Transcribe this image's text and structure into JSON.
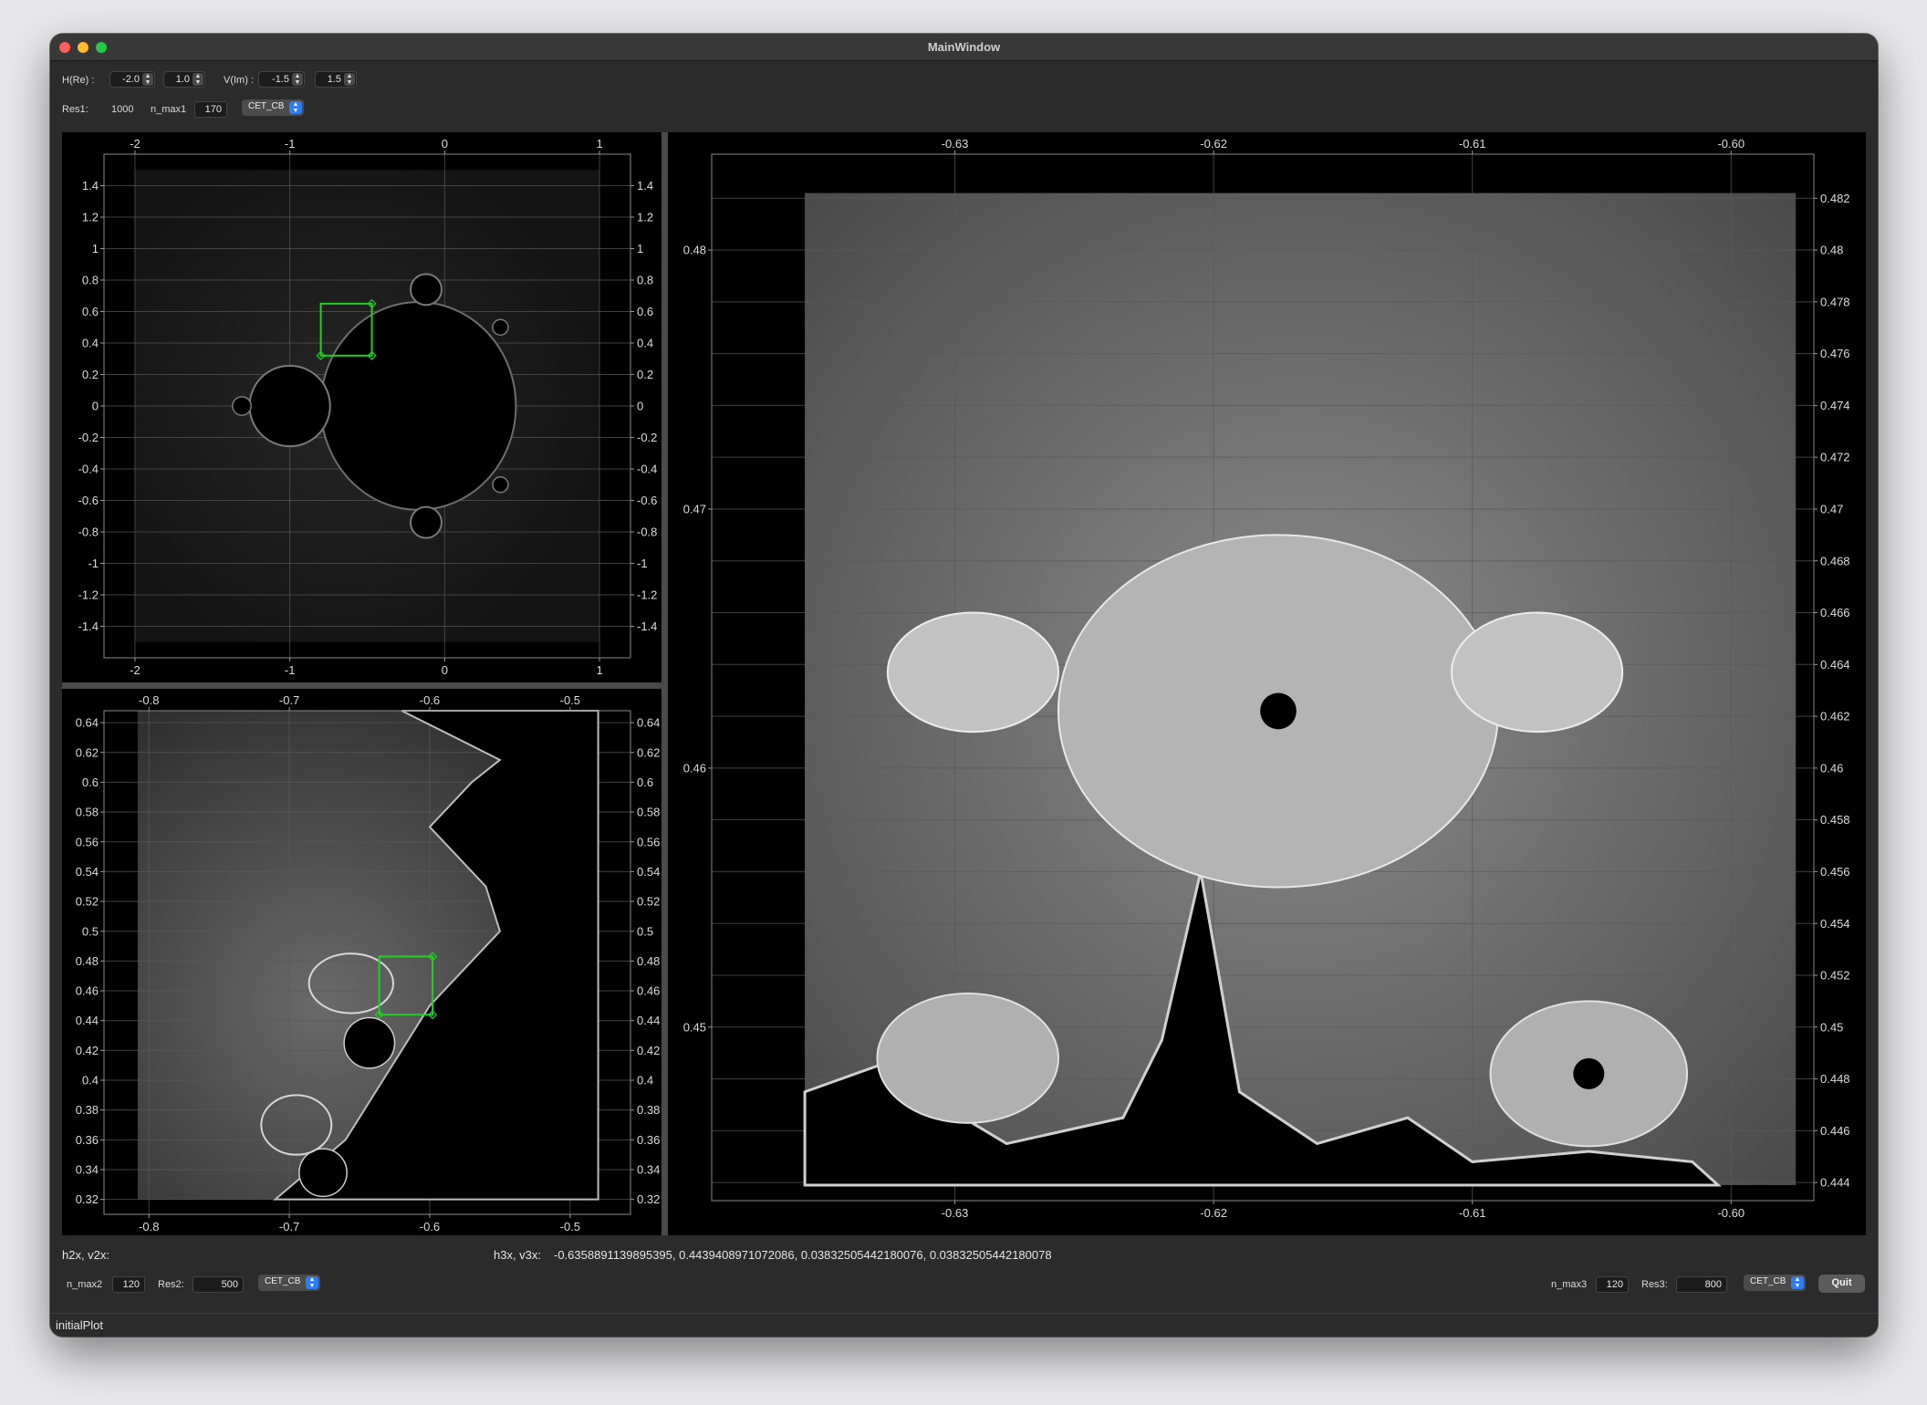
{
  "window": {
    "title": "MainWindow"
  },
  "toolbar1": {
    "h_label": "H(Re) :",
    "h_min": "-2.0",
    "h_max": "1.0",
    "v_label": "V(Im) :",
    "v_min": "-1.5",
    "v_max": "1.5"
  },
  "toolbar2": {
    "res1_label": "Res1:",
    "res1_value": "1000",
    "nmax1_label": "n_max1",
    "nmax1_value": "170",
    "colormap1": "CET_CB"
  },
  "plot1": {
    "x_ticks": [
      "-2",
      "-1",
      "0",
      "1"
    ],
    "y_ticks": [
      "1.4",
      "1.2",
      "1",
      "0.8",
      "0.6",
      "0.4",
      "0.2",
      "0",
      "-0.2",
      "-0.4",
      "-0.6",
      "-0.8",
      "-1",
      "-1.2",
      "-1.4"
    ],
    "xlim": [
      -2.2,
      1.2
    ],
    "ylim": [
      -1.6,
      1.6
    ]
  },
  "plot2": {
    "x_ticks": [
      "-0.8",
      "-0.7",
      "-0.6",
      "-0.5"
    ],
    "y_ticks": [
      "0.64",
      "0.62",
      "0.6",
      "0.58",
      "0.56",
      "0.54",
      "0.52",
      "0.5",
      "0.48",
      "0.46",
      "0.44",
      "0.42",
      "0.4",
      "0.38",
      "0.36",
      "0.34",
      "0.32"
    ],
    "xlim": [
      -0.832,
      -0.457
    ],
    "ylim": [
      0.31,
      0.648
    ]
  },
  "plot3": {
    "x_ticks": [
      "-0.63",
      "-0.62",
      "-0.61",
      "-0.60"
    ],
    "y_ticks_left": [
      "0.48",
      "0.47",
      "0.46",
      "0.45"
    ],
    "y_ticks_right": [
      "0.482",
      "0.48",
      "0.478",
      "0.476",
      "0.474",
      "0.472",
      "0.47",
      "0.468",
      "0.466",
      "0.464",
      "0.462",
      "0.46",
      "0.458",
      "0.456",
      "0.454",
      "0.452",
      "0.45",
      "0.448",
      "0.446",
      "0.444"
    ],
    "xlim": [
      -0.6394,
      -0.5968
    ],
    "ylim": [
      0.4433,
      0.4837
    ]
  },
  "readouts": {
    "h2_label": "h2x, v2x:",
    "h3_label": "h3x, v3x:",
    "h3_value": "-0.6358891139895395, 0.4439408971072086, 0.03832505442180076, 0.03832505442180078"
  },
  "bottom_left": {
    "nmax2_label": "n_max2",
    "nmax2_value": "120",
    "res2_label": "Res2:",
    "res2_value": "500",
    "colormap2": "CET_CB"
  },
  "bottom_right": {
    "nmax3_label": "n_max3",
    "nmax3_value": "120",
    "res3_label": "Res3:",
    "res3_value": "800",
    "colormap3": "CET_CB",
    "quit_label": "Quit"
  },
  "status": {
    "text": "initialPlot"
  },
  "colors": {
    "roi": "#1fd21f",
    "grid": "#5a5a5a",
    "background": "#000000"
  }
}
